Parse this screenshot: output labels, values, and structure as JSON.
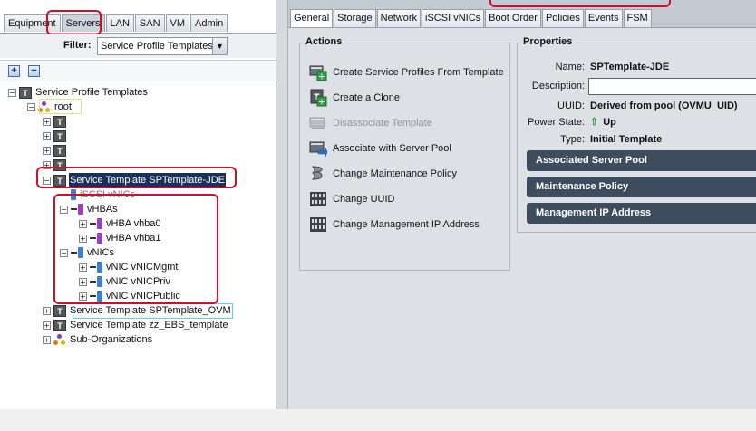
{
  "nav": {
    "tabs": [
      {
        "label": "Equipment"
      },
      {
        "label": "Servers"
      },
      {
        "label": "LAN"
      },
      {
        "label": "SAN"
      },
      {
        "label": "VM"
      },
      {
        "label": "Admin"
      }
    ],
    "filter_label": "Filter:",
    "filter_value": "Service Profile Templates",
    "toolbar": {
      "expand": "+",
      "collapse": "−"
    }
  },
  "tree": {
    "root_label": "Service Profile Templates",
    "org_root": "root",
    "selected_template": "Service Template SPTemplate-JDE",
    "iscsi_vnics": "iSCSI vNICs",
    "vhbas": "vHBAs",
    "vhba_items": [
      "vHBA vhba0",
      "vHBA vhba1"
    ],
    "vnics": "vNICs",
    "vnic_items": [
      "vNIC vNICMgmt",
      "vNIC vNICPriv",
      "vNIC vNICPublic"
    ],
    "other_templates": [
      "Service Template SPTemplate_OVM",
      "Service Template zz_EBS_template"
    ],
    "sub_orgs": "Sub-Organizations",
    "icon_text": "T"
  },
  "content": {
    "tabs": [
      {
        "label": "General"
      },
      {
        "label": "Storage"
      },
      {
        "label": "Network"
      },
      {
        "label": "iSCSI vNICs"
      },
      {
        "label": "Boot Order"
      },
      {
        "label": "Policies"
      },
      {
        "label": "Events"
      },
      {
        "label": "FSM"
      }
    ],
    "actions_title": "Actions",
    "actions": [
      {
        "label": "Create Service Profiles From Template",
        "icon": "create-profiles-icon",
        "enabled": true
      },
      {
        "label": "Create a Clone",
        "icon": "clone-icon",
        "enabled": true
      },
      {
        "label": "Disassociate Template",
        "icon": "disassociate-icon",
        "enabled": false
      },
      {
        "label": "Associate with Server Pool",
        "icon": "associate-pool-icon",
        "enabled": true
      },
      {
        "label": "Change Maintenance Policy",
        "icon": "maintenance-policy-icon",
        "enabled": true
      },
      {
        "label": "Change UUID",
        "icon": "uuid-icon",
        "enabled": true
      },
      {
        "label": "Change Management IP Address",
        "icon": "mgmt-ip-icon",
        "enabled": true
      }
    ],
    "properties_title": "Properties",
    "properties": {
      "name_label": "Name:",
      "name_value": "SPTemplate-JDE",
      "description_label": "Description:",
      "description_value": "",
      "uuid_label": "UUID:",
      "uuid_value": "Derived from pool (OVMU_UID)",
      "power_label": "Power State:",
      "power_value": "Up",
      "type_label": "Type:",
      "type_value": "Initial Template"
    },
    "sections": [
      "Associated Server Pool",
      "Maintenance Policy",
      "Management IP Address"
    ]
  },
  "colors": {
    "highlight_red": "#d10e2a",
    "selected_bg": "#1b2f5c",
    "section_bar": "#3e4d5e",
    "power_up_green": "#2e9a2e"
  }
}
